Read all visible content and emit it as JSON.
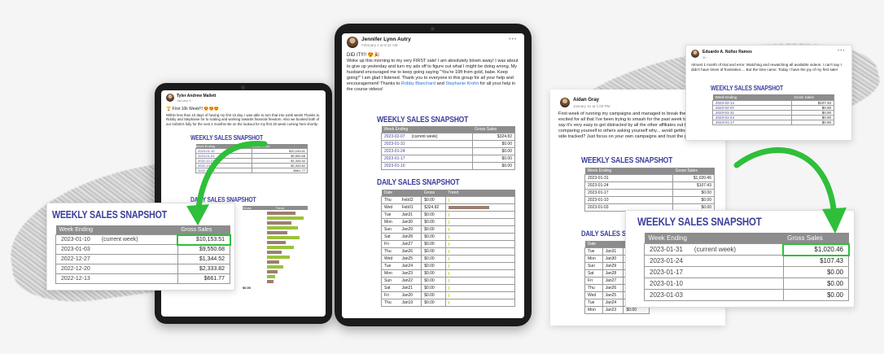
{
  "colors": {
    "accent_green": "#2fbf3a",
    "title_blue": "#3b3f9c",
    "header_grey": "#8d8d8d",
    "bar_brown": "#9b7f6f",
    "bar_green": "#9bc23c"
  },
  "left": {
    "post": {
      "name": "Tyler Andrew Mallett",
      "meta": "January 9 · ",
      "heading": "🏆 First 10k Week!!! 😍😍😍",
      "text": "Within less than 10 days of having my first 1k day, I was able to turn that into a10k week! Thanks to Robby and Stephanie for to scaling and working towards financial freedom. Also we booked both of our Airbnb's fully for the next 2 months! Be on the lookout for my first 20 week coming here shortly."
    },
    "snapshot_title": "WEEKLY SALES SNAPSHOT",
    "daily_title": "DAILY SALES SNAPSHOT",
    "headers": [
      "Week Ending",
      "Gross Sales"
    ],
    "small_rows": [
      [
        "2023-01-10",
        "(current week)",
        "$10,153.51"
      ],
      [
        "2023-01-03",
        "",
        "$9,550.68"
      ],
      [
        "2022-12-27",
        "",
        "$1,344.52"
      ],
      [
        "2022-12-20",
        "",
        "$2,333.82"
      ],
      [
        "2022-12-13",
        "",
        "$661.77"
      ]
    ],
    "zoom": {
      "title": "WEEKLY SALES SNAPSHOT",
      "headers": [
        "Week Ending",
        "Gross Sales"
      ],
      "rows": [
        [
          "2023-01-10",
          "(current week)",
          "$10,153.51"
        ],
        [
          "2023-01-03",
          "",
          "$9,550.68"
        ],
        [
          "2022-12-27",
          "",
          "$1,344.52"
        ],
        [
          "2022-12-20",
          "",
          "$2,333.82"
        ],
        [
          "2022-12-13",
          "",
          "$661.77"
        ]
      ]
    },
    "daily_headers": [
      "Date",
      "Gross",
      "Trend"
    ],
    "daily_total": "$0.00"
  },
  "center": {
    "post": {
      "name": "Jennifer Lynn Autry",
      "meta": "February 2 at 8:42 AM · ",
      "heading": "DID IT!!!! 😍🎉",
      "text_before": "Woke up this morning to my very FIRST sale! I am absolutely blown away! I was about to give up yesterday and turn my ads off to figure out what I might be doing wrong. My husband encouraged me to keep going saying \"You're 10ft from gold, babe. Keep going!\" I am glad I listened. Thank you to everyone in this group for all your help and encouragement! Thanks to ",
      "link1": "Robby Blanchard",
      "and": " and ",
      "link2": "Stephanie Krohn",
      "text_after": " for all your help in the course videos!"
    },
    "weekly_title": "WEEKLY SALES SNAPSHOT",
    "weekly_headers": [
      "Week Ending",
      "Gross Sales"
    ],
    "weekly_rows": [
      [
        "2023-02-07",
        "(current week)",
        "$324.82"
      ],
      [
        "2023-01-31",
        "",
        "$0.00"
      ],
      [
        "2023-01-24",
        "",
        "$0.00"
      ],
      [
        "2023-01-17",
        "",
        "$0.00"
      ],
      [
        "2023-01-10",
        "",
        "$0.00"
      ]
    ],
    "daily_title": "DAILY SALES SNAPSHOT",
    "daily_headers": [
      "Date",
      "Gross",
      "Trend"
    ],
    "daily_rows": [
      {
        "day": "Thu",
        "date": "Feb02",
        "gross": "$0.00",
        "trend": 0
      },
      {
        "day": "Wed",
        "date": "Feb01",
        "gross": "$324.82",
        "trend": 1
      },
      {
        "day": "Tue",
        "date": "Jan31",
        "gross": "$0.00",
        "trend": 0
      },
      {
        "day": "Mon",
        "date": "Jan30",
        "gross": "$0.00",
        "trend": 0
      },
      {
        "day": "Sun",
        "date": "Jan29",
        "gross": "$0.00",
        "trend": 0
      },
      {
        "day": "Sat",
        "date": "Jan28",
        "gross": "$0.00",
        "trend": 0
      },
      {
        "day": "Fri",
        "date": "Jan27",
        "gross": "$0.00",
        "trend": 0
      },
      {
        "day": "Thu",
        "date": "Jan26",
        "gross": "$0.00",
        "trend": 0
      },
      {
        "day": "Wed",
        "date": "Jan25",
        "gross": "$0.00",
        "trend": 0
      },
      {
        "day": "Tue",
        "date": "Jan24",
        "gross": "$0.00",
        "trend": 0
      },
      {
        "day": "Mon",
        "date": "Jan23",
        "gross": "$0.00",
        "trend": 0
      },
      {
        "day": "Sun",
        "date": "Jan22",
        "gross": "$0.00",
        "trend": 0
      },
      {
        "day": "Sat",
        "date": "Jan21",
        "gross": "$0.00",
        "trend": 0
      },
      {
        "day": "Fri",
        "date": "Jan20",
        "gross": "$0.00",
        "trend": 0
      },
      {
        "day": "Thu",
        "date": "Jan19",
        "gross": "$0.00",
        "trend": 0
      }
    ]
  },
  "right": {
    "post": {
      "name": "Aidan Gray",
      "meta": "January 31 at 1:00 PM · ",
      "text": "First week of running my campaigns and managed to break the $1k mark! So excited for all that I've been trying to smash for the past week today! What I can say it's very easy to get distracted by all the other affiliates out there online and comparing yourself to others asking yourself why... avoid getting distracted and side tracked? Just focus on your own campaigns and trust the process 😀"
    },
    "weekly_title": "WEEKLY SALES SNAPSHOT",
    "headers": [
      "Week Ending",
      "Gross Sales"
    ],
    "small_rows": [
      [
        "2023-01-31",
        "$1,020.46"
      ],
      [
        "2023-01-24",
        "$107.43"
      ],
      [
        "2023-01-17",
        "$0.00"
      ],
      [
        "2023-01-10",
        "$0.00"
      ],
      [
        "2023-01-03",
        "$0.00"
      ]
    ],
    "daily_title": "DAILY SALES SNAPSHOT",
    "daily_header": "Date",
    "daily_rows": [
      [
        "Tue",
        "Jan31",
        "$"
      ],
      [
        "Mon",
        "Jan30",
        "$"
      ],
      [
        "Sun",
        "Jan29",
        "$"
      ],
      [
        "Sat",
        "Jan28",
        "$"
      ],
      [
        "Fri",
        "Jan27",
        "$"
      ],
      [
        "Thu",
        "Jan26",
        "$"
      ],
      [
        "Wed",
        "Jan25",
        "$"
      ],
      [
        "Tue",
        "Jan24",
        "$107.43"
      ],
      [
        "Mon",
        "Jan23",
        "$0.00"
      ]
    ],
    "zoom": {
      "title": "WEEKLY SALES SNAPSHOT",
      "headers": [
        "Week Ending",
        "Gross Sales"
      ],
      "rows": [
        [
          "2023-01-31",
          "(current week)",
          "$1,020.46"
        ],
        [
          "2023-01-24",
          "",
          "$107.43"
        ],
        [
          "2023-01-17",
          "",
          "$0.00"
        ],
        [
          "2023-01-10",
          "",
          "$0.00"
        ],
        [
          "2023-01-03",
          "",
          "$0.00"
        ]
      ]
    }
  },
  "topright": {
    "post": {
      "name": "Eduardo A. Núñez Ramos",
      "meta": "3h · ",
      "text": "Almost 1 month of trial and error. Watching and rewatching all available videos. I can't say I didn't have times of frustration.... But the time came: Today I have the joy of my first sale!"
    },
    "title": "WEEKLY SALES SNAPSHOT",
    "headers": [
      "Week Ending",
      "Gross Sales"
    ],
    "rows": [
      [
        "2023-02-14",
        "$107.33"
      ],
      [
        "2023-02-07",
        "$0.00"
      ],
      [
        "2023-01-31",
        "$0.00"
      ],
      [
        "2023-01-24",
        "$0.00"
      ],
      [
        "2023-01-17",
        "$0.00"
      ]
    ]
  }
}
